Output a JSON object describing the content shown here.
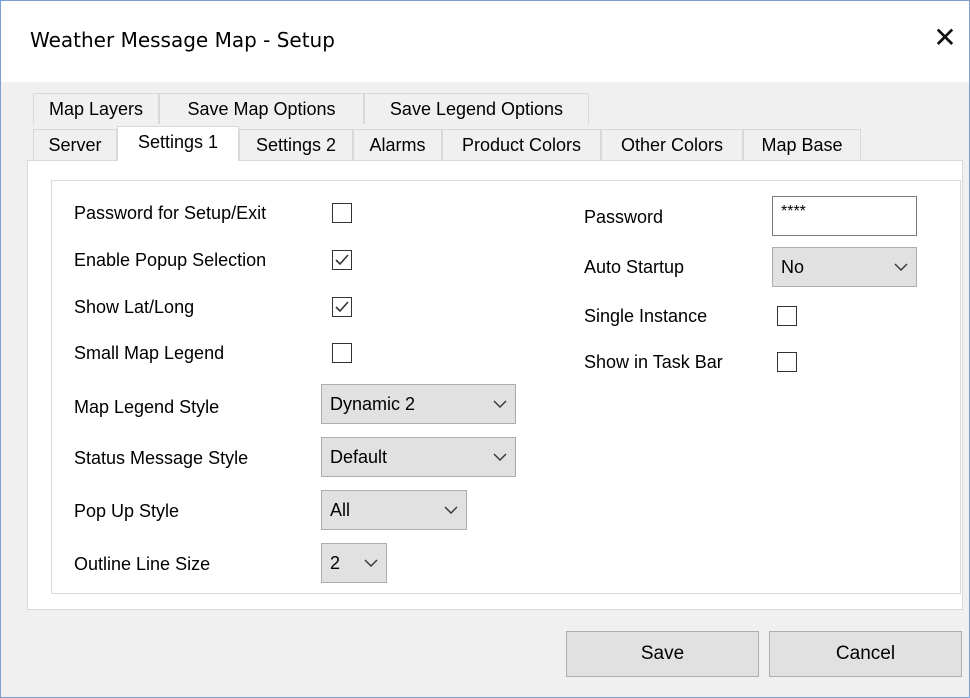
{
  "window": {
    "title": "Weather Message Map - Setup",
    "close_glyph": "✕"
  },
  "tabs_row1": [
    {
      "label": "Map Layers"
    },
    {
      "label": "Save Map Options"
    },
    {
      "label": "Save Legend Options"
    }
  ],
  "tabs_row2": [
    {
      "label": "Server"
    },
    {
      "label": "Settings 1",
      "selected": true
    },
    {
      "label": "Settings 2"
    },
    {
      "label": "Alarms"
    },
    {
      "label": "Product Colors"
    },
    {
      "label": "Other Colors"
    },
    {
      "label": "Map Base"
    }
  ],
  "settings": {
    "password_setup_exit": {
      "label": "Password for Setup/Exit",
      "checked": false
    },
    "enable_popup": {
      "label": "Enable Popup Selection",
      "checked": true
    },
    "show_latlong": {
      "label": "Show Lat/Long",
      "checked": true
    },
    "small_map_legend": {
      "label": "Small Map Legend",
      "checked": false
    },
    "map_legend_style": {
      "label": "Map Legend Style",
      "value": "Dynamic 2"
    },
    "status_message_style": {
      "label": "Status Message Style",
      "value": "Default"
    },
    "popup_style": {
      "label": "Pop Up Style",
      "value": "All"
    },
    "outline_line_size": {
      "label": "Outline Line Size",
      "value": "2"
    },
    "password": {
      "label": "Password",
      "value": "****"
    },
    "auto_startup": {
      "label": "Auto Startup",
      "value": "No"
    },
    "single_instance": {
      "label": "Single Instance",
      "checked": false
    },
    "show_in_taskbar": {
      "label": "Show in Task Bar",
      "checked": false
    }
  },
  "buttons": {
    "save": "Save",
    "cancel": "Cancel"
  },
  "icons": {
    "checkmark": "check-icon",
    "dropdown": "chevron-down-icon",
    "close": "close-icon"
  },
  "colors": {
    "window_border": "#7a9fd0",
    "button_bg": "#e1e1e1",
    "panel_bg": "#ffffff",
    "dialog_bg": "#f0f0f0"
  }
}
